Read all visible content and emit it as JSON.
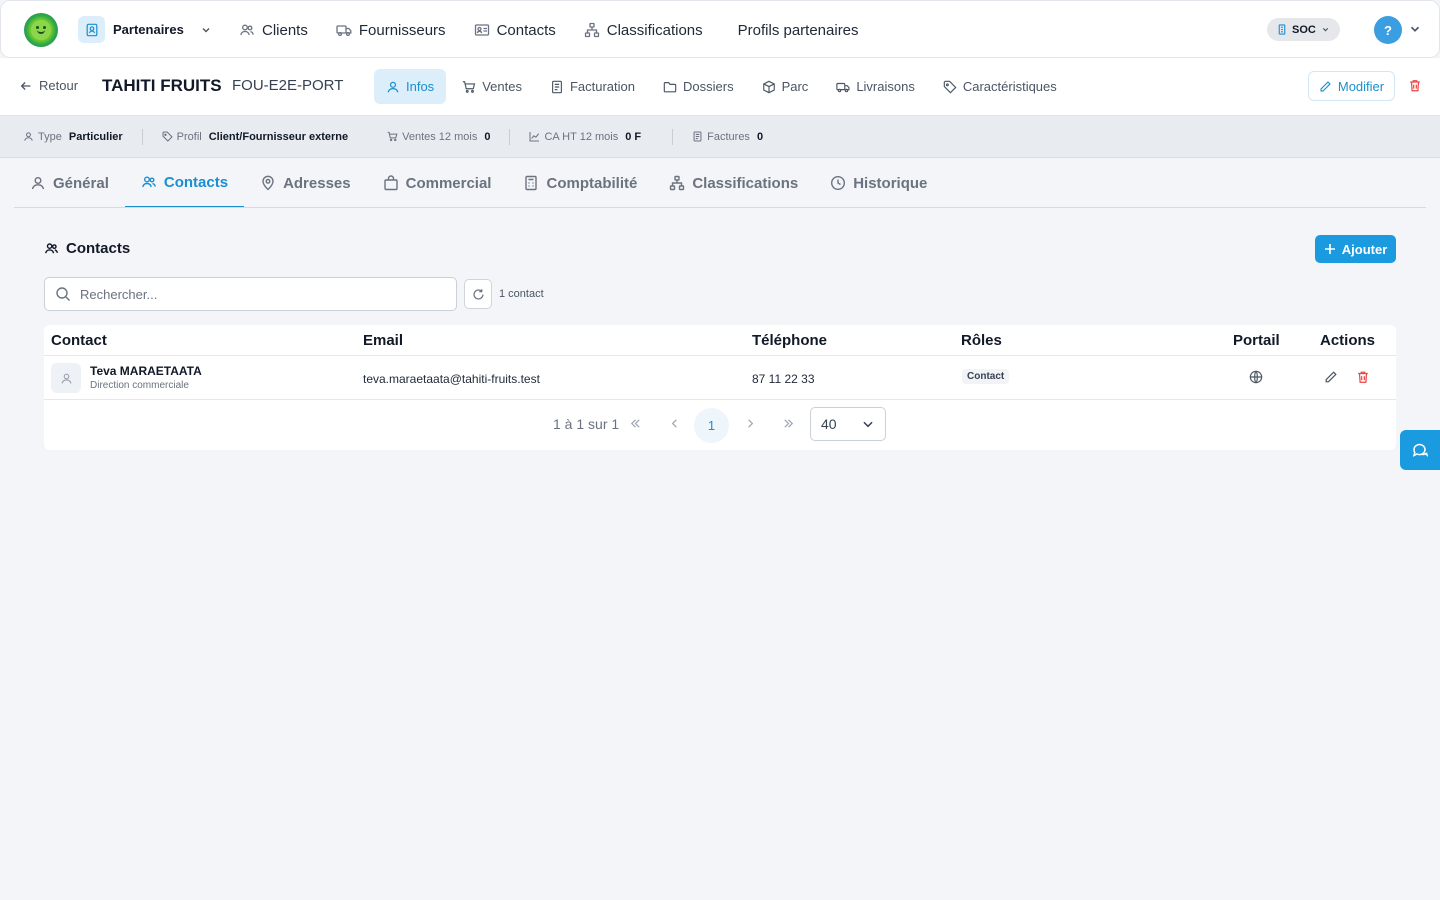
{
  "topbar": {
    "module": "Partenaires",
    "nav": [
      "Clients",
      "Fournisseurs",
      "Contacts",
      "Classifications",
      "Profils partenaires"
    ],
    "company": "SOC",
    "help": "?"
  },
  "partner": {
    "back": "Retour",
    "name": "TAHITI FRUITS",
    "code": "FOU-E2E-PORT",
    "tabs": [
      "Infos",
      "Ventes",
      "Facturation",
      "Dossiers",
      "Parc",
      "Livraisons",
      "Caractéristiques"
    ],
    "modify": "Modifier"
  },
  "stats": {
    "type_label": "Type",
    "type_value": "Particulier",
    "profil_label": "Profil",
    "profil_value": "Client/Fournisseur externe",
    "ventes_label": "Ventes 12 mois",
    "ventes_value": "0",
    "ca_label": "CA HT 12 mois",
    "ca_value": "0 F",
    "factures_label": "Factures",
    "factures_value": "0"
  },
  "subtabs": [
    "Général",
    "Contacts",
    "Adresses",
    "Commercial",
    "Comptabilité",
    "Classifications",
    "Historique"
  ],
  "contacts": {
    "title": "Contacts",
    "add": "Ajouter",
    "search_placeholder": "Rechercher...",
    "count": "1 contact",
    "columns": [
      "Contact",
      "Email",
      "Téléphone",
      "Rôles",
      "Portail",
      "Actions"
    ],
    "rows": [
      {
        "name": "Teva MARAETAATA",
        "role": "Direction commerciale",
        "email": "teva.maraetaata@tahiti-fruits.test",
        "phone": "87 11 22 33",
        "badge": "Contact"
      }
    ],
    "pager_info": "1 à 1 sur 1",
    "current_page": "1",
    "page_size": "40"
  },
  "colors": {
    "accent": "#1a9be0",
    "danger": "#ef4444"
  }
}
